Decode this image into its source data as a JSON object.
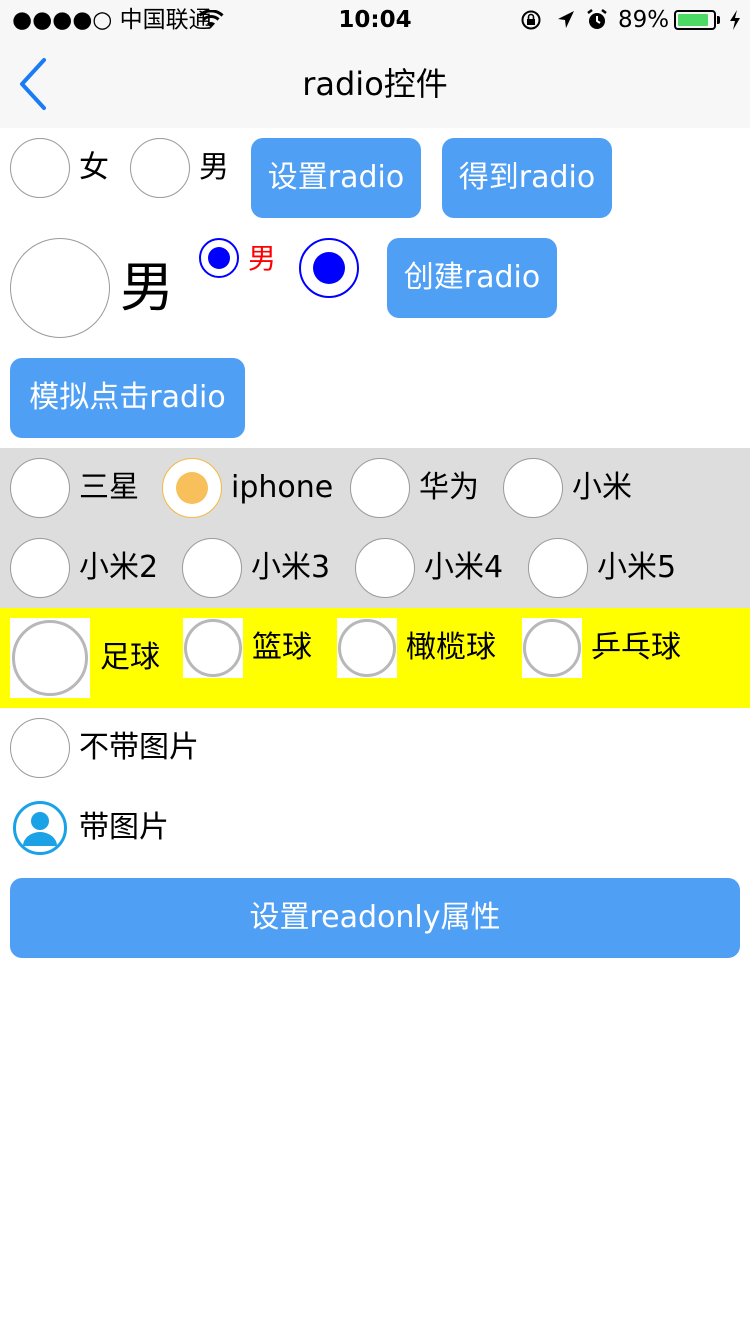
{
  "status_bar": {
    "carrier": "●●●●○ 中国联通",
    "time": "10:04",
    "battery_percent": "89%",
    "battery_level": 0.89
  },
  "nav": {
    "title": "radio控件"
  },
  "row1": {
    "radio_female_label": "女",
    "radio_male_label": "男",
    "set_radio_button": "设置radio",
    "get_radio_button": "得到radio"
  },
  "row2": {
    "big_radio_label": "男",
    "small_checked_label": "男",
    "create_radio_button": "创建radio"
  },
  "row3": {
    "simulate_click_button": "模拟点击radio"
  },
  "phones": {
    "row1": [
      "三星",
      "iphone",
      "华为",
      "小米"
    ],
    "row2": [
      "小米2",
      "小米3",
      "小米4",
      "小米5"
    ],
    "selected": "iphone",
    "selected_color": "#f7c05a"
  },
  "sports": {
    "items": [
      "足球",
      "篮球",
      "橄榄球",
      "乒乓球"
    ]
  },
  "image_options": {
    "no_image_label": "不带图片",
    "with_image_label": "带图片",
    "icon_color": "#1aa1e6"
  },
  "readonly_button": "设置readonly属性",
  "colors": {
    "button": "#4f9ff5",
    "accent_blue": "#0000ff",
    "red_label": "#ff0000",
    "gray_band": "#dddddd",
    "yellow_band": "#ffff00"
  }
}
